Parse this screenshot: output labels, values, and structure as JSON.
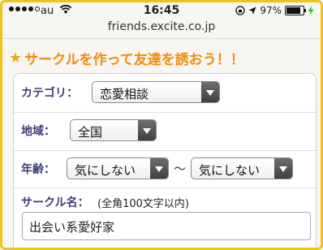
{
  "status_bar": {
    "carrier": "au",
    "time": "16:45",
    "battery": "97%",
    "signal_dots_filled": 4,
    "icons": [
      "wifi-icon",
      "rotation-lock-icon",
      "location-arrow-icon",
      "charging-bolt-icon"
    ]
  },
  "browser": {
    "url": "friends.excite.co.jp"
  },
  "heading": {
    "icon": "star-icon",
    "title": "サークルを作って友達を誘おう！！"
  },
  "form": {
    "category": {
      "label": "カテゴリ：",
      "selected": "恋愛相談"
    },
    "region": {
      "label": "地域：",
      "selected": "全国"
    },
    "age": {
      "label": "年齢：",
      "min_selected": "気にしない",
      "separator": "〜",
      "max_selected": "気にしない"
    },
    "circle_name": {
      "label": "サークル名：",
      "hint": "(全角100文字以内)",
      "value": "出会い系愛好家"
    }
  },
  "colors": {
    "frame": "#f2c21b",
    "heading": "#f08c0a",
    "label": "#3e3e7a"
  }
}
